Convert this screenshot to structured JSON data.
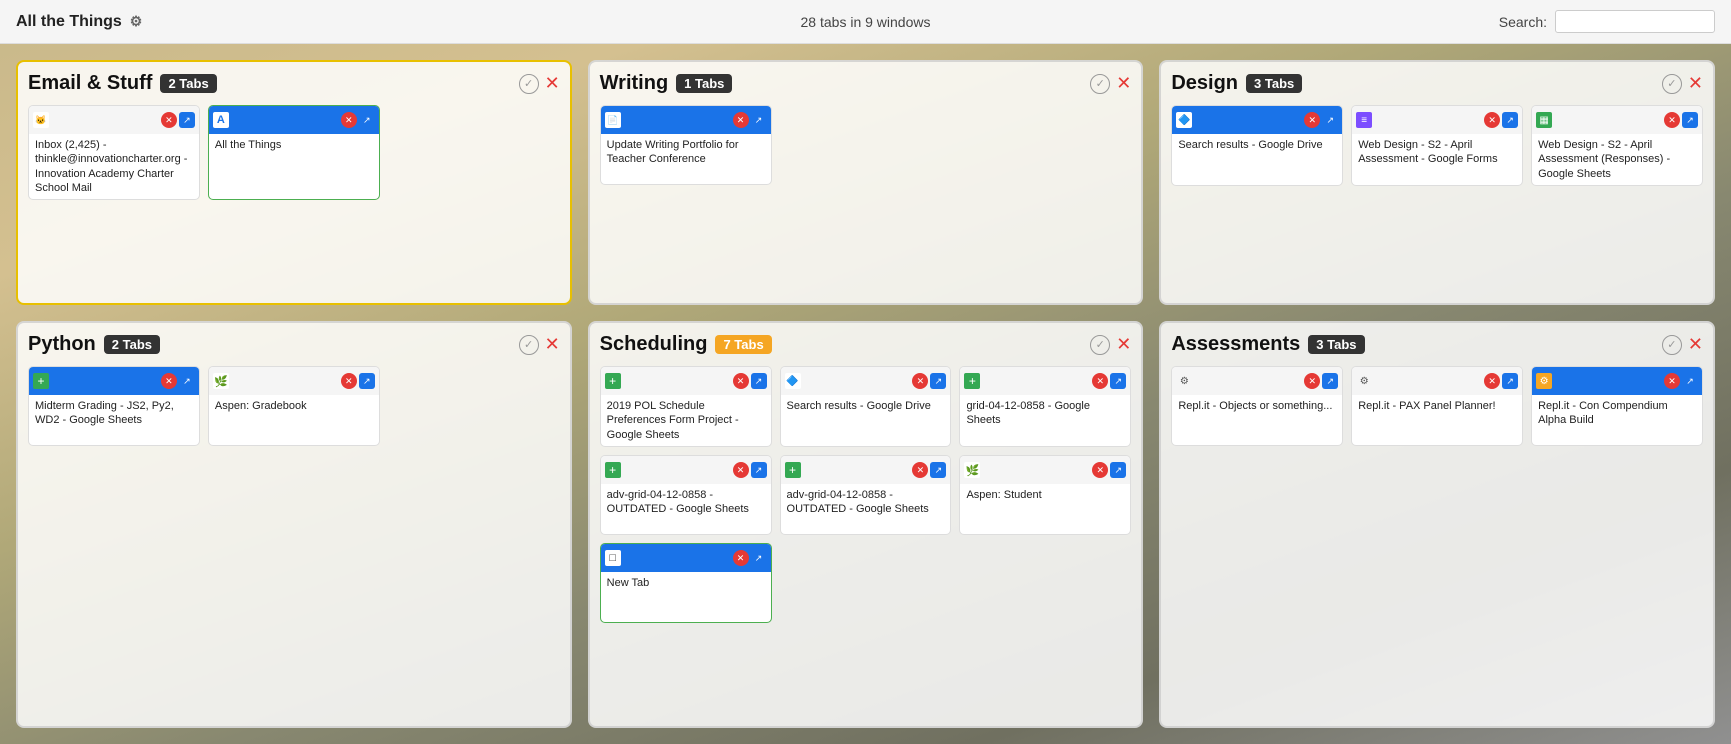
{
  "header": {
    "title": "All the Things",
    "gear_icon": "⚙",
    "stats": "28 tabs in 9 windows",
    "search_label": "Search:",
    "search_placeholder": ""
  },
  "windows": [
    {
      "id": "email",
      "title": "Email & Stuff",
      "badge": "2 Tabs",
      "badge_color": "dark",
      "border": "yellow",
      "tabs": [
        {
          "favicon_type": "mail",
          "favicon_char": "🐱",
          "header_bg": "white-bg",
          "text": "Inbox (2,425) - thinkle@innovationcharter.org - Innovation Academy Charter School Mail",
          "active": false
        },
        {
          "favicon_type": "docs",
          "favicon_char": "A",
          "header_bg": "blue-bg",
          "text": "All the Things",
          "active": true
        }
      ]
    },
    {
      "id": "writing",
      "title": "Writing",
      "badge": "1 Tabs",
      "badge_color": "dark",
      "border": "normal",
      "tabs": [
        {
          "favicon_type": "docs",
          "favicon_char": "📄",
          "header_bg": "blue-bg",
          "text": "Update Writing Portfolio for Teacher Conference",
          "active": false
        }
      ]
    },
    {
      "id": "design",
      "title": "Design",
      "badge": "3 Tabs",
      "badge_color": "dark",
      "border": "normal",
      "tabs": [
        {
          "favicon_type": "drive",
          "favicon_char": "△",
          "header_bg": "blue-bg",
          "text": "Search results - Google Drive",
          "active": false
        },
        {
          "favicon_type": "forms",
          "favicon_char": "≡",
          "header_bg": "white-bg",
          "text": "Web Design - S2 - April Assessment - Google Forms",
          "active": false
        },
        {
          "favicon_type": "sheets",
          "favicon_char": "▦",
          "header_bg": "white-bg",
          "text": "Web Design - S2 - April Assessment (Responses) - Google Sheets",
          "active": false
        }
      ]
    },
    {
      "id": "python",
      "title": "Python",
      "badge": "2 Tabs",
      "badge_color": "dark",
      "border": "normal",
      "tabs": [
        {
          "favicon_type": "sheets",
          "favicon_char": "+",
          "header_bg": "blue-bg",
          "text": "Midterm Grading - JS2, Py2, WD2 - Google Sheets",
          "active": false
        },
        {
          "favicon_type": "aspen",
          "favicon_char": "🌿",
          "header_bg": "white-bg",
          "text": "Aspen: Gradebook",
          "active": false
        }
      ]
    },
    {
      "id": "scheduling",
      "title": "Scheduling",
      "badge": "7 Tabs",
      "badge_color": "yellow",
      "border": "normal",
      "tabs": [
        {
          "favicon_type": "sheets",
          "favicon_char": "+",
          "header_bg": "white-bg",
          "text": "2019 POL Schedule Preferences Form Project - Google Sheets",
          "active": false
        },
        {
          "favicon_type": "drive",
          "favicon_char": "△",
          "header_bg": "white-bg",
          "text": "Search results - Google Drive",
          "active": false
        },
        {
          "favicon_type": "sheets",
          "favicon_char": "+",
          "header_bg": "white-bg",
          "text": "grid-04-12-0858 - Google Sheets",
          "active": false
        },
        {
          "favicon_type": "sheets",
          "favicon_char": "+",
          "header_bg": "white-bg",
          "text": "adv-grid-04-12-0858 - OUTDATED - Google Sheets",
          "active": false
        },
        {
          "favicon_type": "sheets",
          "favicon_char": "+",
          "header_bg": "white-bg",
          "text": "adv-grid-04-12-0858 - OUTDATED - Google Sheets",
          "active": false
        },
        {
          "favicon_type": "aspen",
          "favicon_char": "🌿",
          "header_bg": "white-bg",
          "text": "Aspen: Student",
          "active": false
        },
        {
          "favicon_type": "newtab",
          "favicon_char": "□",
          "header_bg": "blue-bg",
          "text": "New Tab",
          "active": true
        }
      ]
    },
    {
      "id": "assessments",
      "title": "Assessments",
      "badge": "3 Tabs",
      "badge_color": "dark",
      "border": "normal",
      "tabs": [
        {
          "favicon_type": "replit",
          "favicon_char": "⚙",
          "header_bg": "white-bg",
          "text": "Repl.it - Objects or something...",
          "active": false
        },
        {
          "favicon_type": "replit",
          "favicon_char": "⚙",
          "header_bg": "white-bg",
          "text": "Repl.it - PAX Panel Planner!",
          "active": false
        },
        {
          "favicon_type": "replit",
          "favicon_char": "⚙",
          "header_bg": "blue-bg",
          "text": "Repl.it - Con Compendium Alpha Build",
          "active": false
        }
      ]
    }
  ]
}
